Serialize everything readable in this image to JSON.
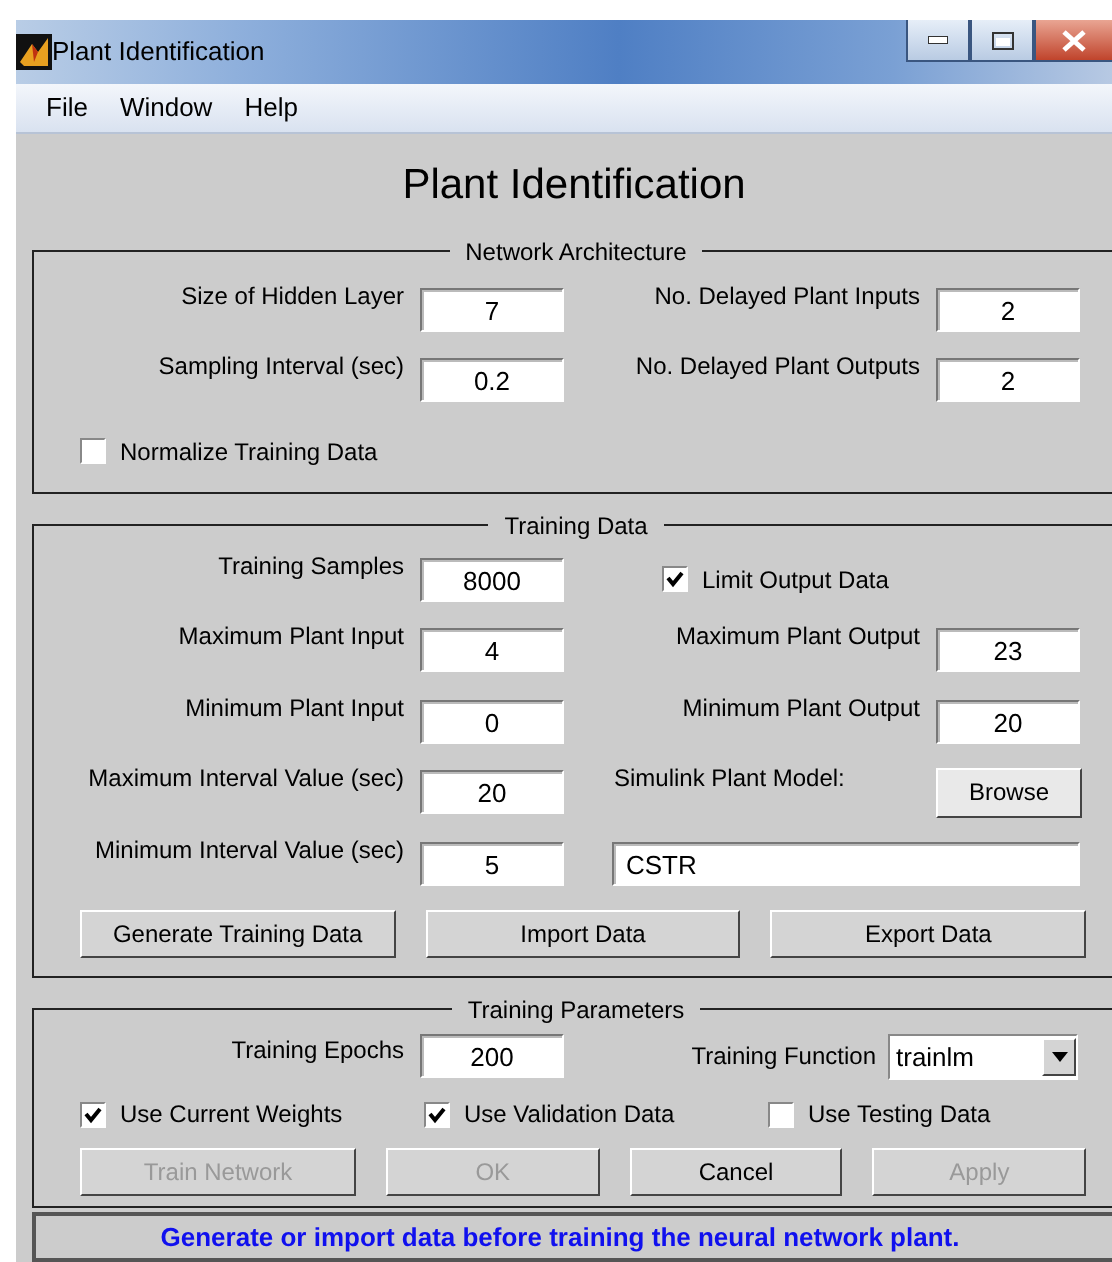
{
  "window": {
    "title": "Plant Identification"
  },
  "menu": [
    "File",
    "Window",
    "Help"
  ],
  "heading": "Plant Identification",
  "frames": [
    {
      "title": "Network Architecture",
      "rows": [
        {
          "kind": "grid",
          "items": [
            {
              "kind": "label",
              "text": "Size of Hidden Layer"
            },
            {
              "kind": "field",
              "value": "7"
            },
            {
              "kind": "label",
              "text": "No. Delayed Plant Inputs"
            },
            {
              "kind": "field",
              "value": "2"
            }
          ]
        },
        {
          "kind": "grid",
          "items": [
            {
              "kind": "label",
              "text": "Sampling Interval (sec)"
            },
            {
              "kind": "field",
              "value": "0.2"
            },
            {
              "kind": "label",
              "text": "No. Delayed Plant Outputs"
            },
            {
              "kind": "field",
              "value": "2"
            }
          ]
        },
        {
          "kind": "checks",
          "items": [
            {
              "label": "Normalize Training Data",
              "checked": false
            }
          ]
        }
      ]
    },
    {
      "title": "Training Data",
      "rows": [
        {
          "kind": "grid",
          "items": [
            {
              "kind": "label",
              "text": "Training Samples"
            },
            {
              "kind": "field",
              "value": "8000"
            },
            {
              "kind": "checkbox",
              "label": "Limit Output Data",
              "checked": true
            }
          ]
        },
        {
          "kind": "grid",
          "items": [
            {
              "kind": "label",
              "text": "Maximum Plant Input"
            },
            {
              "kind": "field",
              "value": "4"
            },
            {
              "kind": "label",
              "text": "Maximum Plant Output"
            },
            {
              "kind": "field",
              "value": "23"
            }
          ]
        },
        {
          "kind": "grid",
          "items": [
            {
              "kind": "label",
              "text": "Minimum Plant Input"
            },
            {
              "kind": "field",
              "value": "0"
            },
            {
              "kind": "label",
              "text": "Minimum Plant Output"
            },
            {
              "kind": "field",
              "value": "20"
            }
          ]
        },
        {
          "kind": "grid",
          "items": [
            {
              "kind": "label",
              "text": "Maximum Interval Value (sec)"
            },
            {
              "kind": "field",
              "value": "20"
            },
            {
              "kind": "note",
              "text": "Simulink Plant Model:"
            },
            {
              "kind": "button",
              "label": "Browse",
              "disabled": false
            }
          ]
        },
        {
          "kind": "grid",
          "items": [
            {
              "kind": "label",
              "text": "Minimum Interval Value (sec)"
            },
            {
              "kind": "field",
              "value": "5"
            },
            {
              "kind": "wide_field",
              "value": "CSTR"
            }
          ]
        },
        {
          "kind": "buttons",
          "items": [
            {
              "label": "Generate Training Data",
              "disabled": false
            },
            {
              "label": "Import Data",
              "disabled": false
            },
            {
              "label": "Export Data",
              "disabled": false
            }
          ]
        }
      ]
    },
    {
      "title": "Training Parameters",
      "rows": [
        {
          "kind": "grid",
          "items": [
            {
              "kind": "label",
              "text": "Training Epochs"
            },
            {
              "kind": "field",
              "value": "200"
            },
            {
              "kind": "select",
              "label": "Training Function",
              "value": "trainlm"
            }
          ]
        },
        {
          "kind": "checks",
          "items": [
            {
              "label": "Use Current Weights",
              "checked": true
            },
            {
              "label": "Use Validation Data",
              "checked": true
            },
            {
              "label": "Use Testing Data",
              "checked": false
            }
          ]
        },
        {
          "kind": "buttons",
          "items": [
            {
              "label": "Train Network",
              "disabled": true
            },
            {
              "label": "OK",
              "disabled": true
            },
            {
              "label": "Cancel",
              "disabled": false
            },
            {
              "label": "Apply",
              "disabled": true
            }
          ]
        }
      ]
    }
  ],
  "status": "Generate or import data before training the neural network plant."
}
